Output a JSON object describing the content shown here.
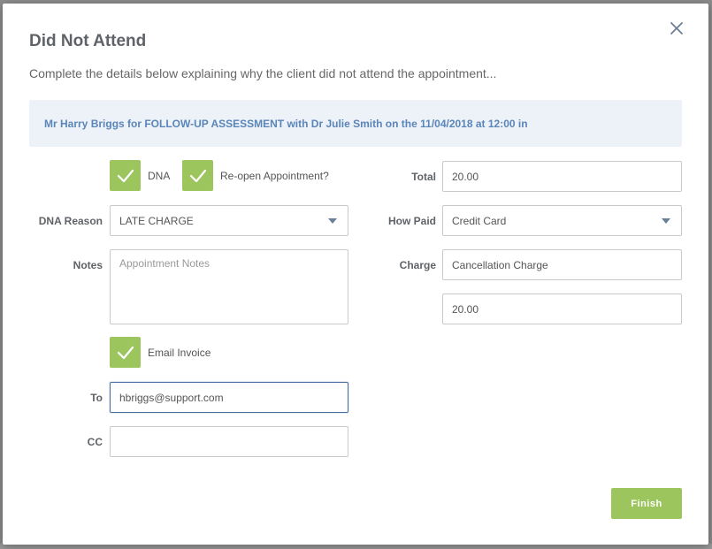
{
  "modal": {
    "title": "Did Not Attend",
    "subtitle": "Complete the details below explaining why the client did not attend the appointment...",
    "banner": "Mr Harry Briggs for FOLLOW-UP ASSESSMENT with Dr Julie Smith on the 11/04/2018 at 12:00 in"
  },
  "left": {
    "dna_label": "DNA",
    "reopen_label": "Re-open Appointment?",
    "dna_reason_label": "DNA Reason",
    "dna_reason_value": "LATE CHARGE",
    "notes_label": "Notes",
    "notes_placeholder": "Appointment Notes",
    "email_invoice_label": "Email Invoice",
    "to_label": "To",
    "to_value": "hbriggs@support.com",
    "cc_label": "CC",
    "cc_value": ""
  },
  "right": {
    "total_label": "Total",
    "total_value": "20.00",
    "how_paid_label": "How Paid",
    "how_paid_value": "Credit Card",
    "charge_label": "Charge",
    "charge_value": "Cancellation Charge",
    "charge_amount": "20.00"
  },
  "actions": {
    "finish_label": "Finish"
  },
  "colors": {
    "accent_green": "#9dc55d",
    "banner_bg": "#edf2f8",
    "banner_text": "#5a85b8"
  },
  "icons": {
    "close": "close-icon",
    "check": "check-icon",
    "caret": "chevron-down-icon"
  }
}
